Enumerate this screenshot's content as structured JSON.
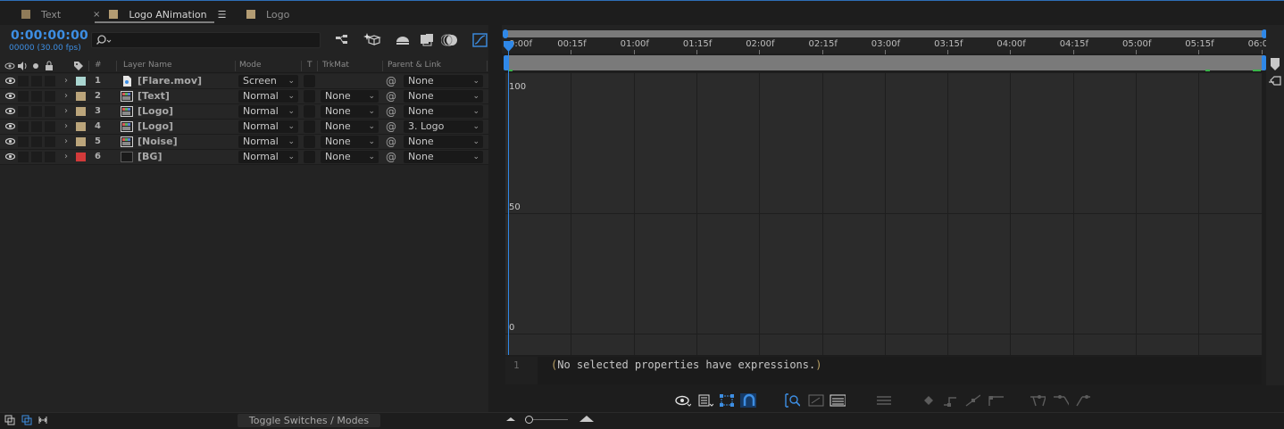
{
  "tabs": [
    {
      "label": "Text",
      "color": "#8f7b59",
      "active": false
    },
    {
      "label": "Logo ANimation",
      "color": "#b39c73",
      "active": true
    },
    {
      "label": "Logo",
      "color": "#b39c73",
      "active": false
    }
  ],
  "timeline": {
    "timecode": "0:00:00:00",
    "frames_fps": "00000 (30.00 fps)",
    "search_placeholder": ""
  },
  "columns": {
    "num": "#",
    "layer_name": "Layer Name",
    "mode": "Mode",
    "t": "T",
    "trkmat": "TrkMat",
    "parent": "Parent & Link"
  },
  "layers": [
    {
      "num": "1",
      "name": "[Flare.mov]",
      "label_color": "#a9d5d0",
      "icon": "footage-file-icon",
      "mode": "Screen",
      "trkmat": "",
      "parent": "None"
    },
    {
      "num": "2",
      "name": "[Text]",
      "label_color": "#bba57b",
      "icon": "composition-icon",
      "mode": "Normal",
      "trkmat": "None",
      "parent": "None"
    },
    {
      "num": "3",
      "name": "[Logo]",
      "label_color": "#bba57b",
      "icon": "composition-icon",
      "mode": "Normal",
      "trkmat": "None",
      "parent": "None"
    },
    {
      "num": "4",
      "name": "[Logo]",
      "label_color": "#bba57b",
      "icon": "composition-icon",
      "mode": "Normal",
      "trkmat": "None",
      "parent": "3. Logo"
    },
    {
      "num": "5",
      "name": "[Noise]",
      "label_color": "#bba57b",
      "icon": "composition-icon",
      "mode": "Normal",
      "trkmat": "None",
      "parent": "None"
    },
    {
      "num": "6",
      "name": "[BG]",
      "label_color": "#d23a3a",
      "icon": "solid-icon",
      "mode": "Normal",
      "trkmat": "None",
      "parent": "None"
    }
  ],
  "ruler": [
    "0:00f",
    "00:15f",
    "01:00f",
    "01:15f",
    "02:00f",
    "02:15f",
    "03:00f",
    "03:15f",
    "04:00f",
    "04:15f",
    "05:00f",
    "05:15f",
    "06:0"
  ],
  "graph": {
    "y_labels": [
      "100",
      "50",
      "0"
    ]
  },
  "expression": {
    "line_number": "1",
    "text": "(No selected properties have expressions.)"
  },
  "bottom": {
    "toggle_label": "Toggle Switches / Modes"
  },
  "colors": {
    "accent": "#2f88e8",
    "timecode": "#3d8ee3"
  }
}
